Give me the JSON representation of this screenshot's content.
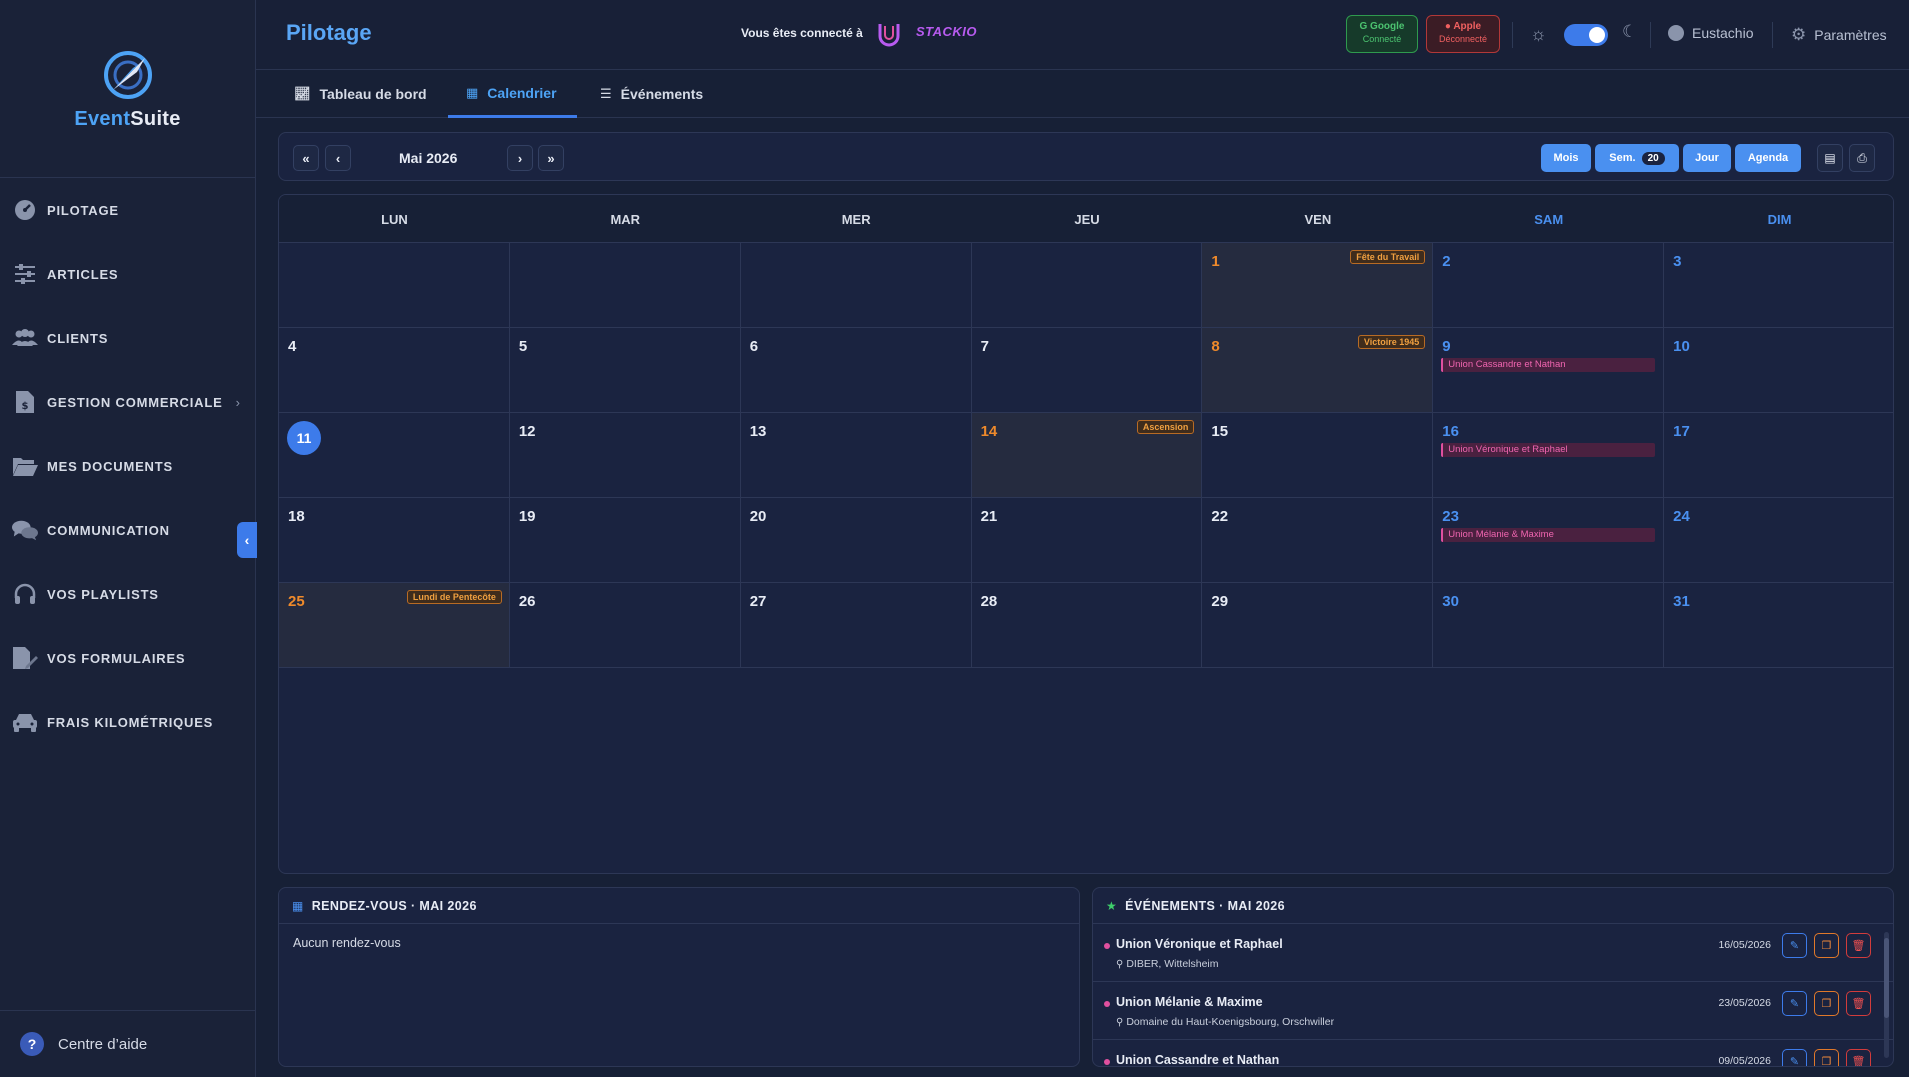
{
  "app": {
    "logo_prefix": "Event",
    "logo_suffix": "Suite"
  },
  "sidebar": {
    "items": [
      {
        "label": "PILOTAGE",
        "icon": "gauge-icon"
      },
      {
        "label": "ARTICLES",
        "icon": "sliders-icon"
      },
      {
        "label": "CLIENTS",
        "icon": "users-icon"
      },
      {
        "label": "GESTION COMMERCIALE",
        "icon": "invoice-dollar-icon"
      },
      {
        "label": "MES DOCUMENTS",
        "icon": "folder-open-icon"
      },
      {
        "label": "COMMUNICATION",
        "icon": "chat-bubbles-icon"
      },
      {
        "label": "VOS PLAYLISTS",
        "icon": "headphones-icon"
      },
      {
        "label": "VOS FORMULAIRES",
        "icon": "file-edit-icon"
      },
      {
        "label": "FRAIS KILOMÉTRIQUES",
        "icon": "car-icon"
      }
    ],
    "help_label": "Centre d’aide"
  },
  "header": {
    "title": "Pilotage",
    "connected_text": "Vous êtes connecté à",
    "partner": "STACKIO",
    "google": {
      "name": "Google",
      "status": "Connecté",
      "color": "#4cc370"
    },
    "apple": {
      "name": "Apple",
      "status": "Déconnecté",
      "color": "#f06060"
    },
    "dark_mode": true,
    "user_name": "Eustachio",
    "settings_label": "Paramètres"
  },
  "tabs": [
    {
      "label": "Tableau de bord",
      "icon": "chart-line-icon",
      "active": false
    },
    {
      "label": "Calendrier",
      "icon": "calendar-icon",
      "active": true
    },
    {
      "label": "Événements",
      "icon": "list-icon",
      "active": false
    }
  ],
  "toolbar": {
    "first": "«",
    "prev": "‹",
    "next": "›",
    "last": "»",
    "month_label": "Mai 2026",
    "views": [
      {
        "label": "Mois"
      },
      {
        "label": "Sem.",
        "count": "20"
      },
      {
        "label": "Jour"
      },
      {
        "label": "Agenda"
      }
    ]
  },
  "calendar": {
    "weekdays": [
      "LUN",
      "MAR",
      "MER",
      "JEU",
      "VEN",
      "SAM",
      "DIM"
    ],
    "weeks": [
      [
        {
          "d": ""
        },
        {
          "d": ""
        },
        {
          "d": ""
        },
        {
          "d": ""
        },
        {
          "d": "1",
          "holiday": "Fête du Travail"
        },
        {
          "d": "2"
        },
        {
          "d": "3"
        }
      ],
      [
        {
          "d": "4"
        },
        {
          "d": "5"
        },
        {
          "d": "6"
        },
        {
          "d": "7"
        },
        {
          "d": "8",
          "holiday": "Victoire 1945"
        },
        {
          "d": "9",
          "event": "Union Cassandre et Nathan"
        },
        {
          "d": "10"
        }
      ],
      [
        {
          "d": "11",
          "today": true
        },
        {
          "d": "12"
        },
        {
          "d": "13"
        },
        {
          "d": "14",
          "holiday": "Ascension"
        },
        {
          "d": "15"
        },
        {
          "d": "16",
          "event": "Union Véronique et Raphael"
        },
        {
          "d": "17"
        }
      ],
      [
        {
          "d": "18"
        },
        {
          "d": "19"
        },
        {
          "d": "20"
        },
        {
          "d": "21"
        },
        {
          "d": "22"
        },
        {
          "d": "23",
          "event": "Union Mélanie & Maxime"
        },
        {
          "d": "24"
        }
      ],
      [
        {
          "d": "25",
          "holiday": "Lundi de Pentecôte"
        },
        {
          "d": "26"
        },
        {
          "d": "27"
        },
        {
          "d": "28"
        },
        {
          "d": "29"
        },
        {
          "d": "30"
        },
        {
          "d": "31"
        }
      ]
    ]
  },
  "rendezvous": {
    "title": "RENDEZ-VOUS · MAI 2026",
    "empty": "Aucun rendez-vous"
  },
  "events_panel": {
    "title": "ÉVÉNEMENTS · MAI 2026",
    "items": [
      {
        "title": "Union Véronique et Raphael",
        "location": "DIBER, Wittelsheim",
        "date": "16/05/2026"
      },
      {
        "title": "Union Mélanie & Maxime",
        "location": "Domaine du Haut-Koenigsbourg, Orschwiller",
        "date": "23/05/2026"
      },
      {
        "title": "Union Cassandre et Nathan",
        "location": "",
        "date": "09/05/2026"
      }
    ]
  }
}
